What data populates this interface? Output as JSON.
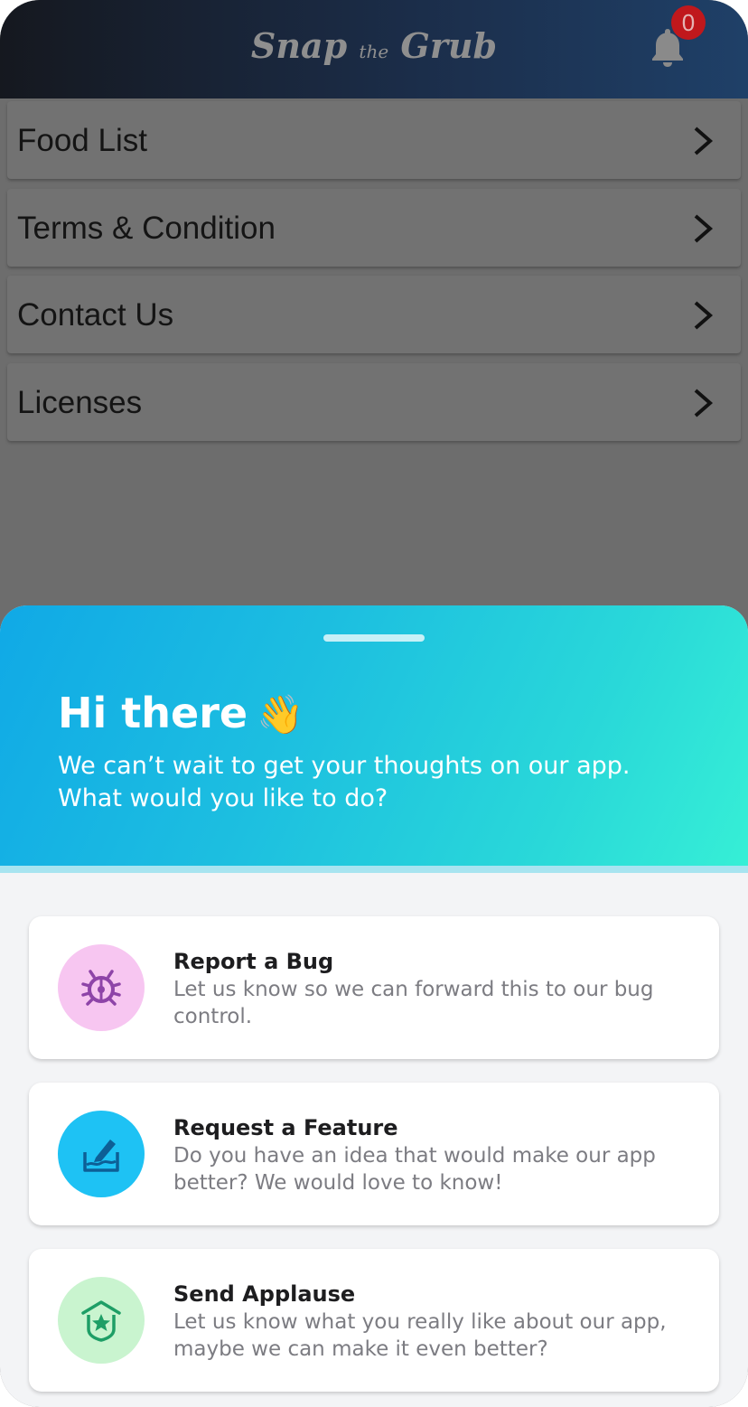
{
  "header": {
    "logo_main1": "Snap",
    "logo_small": "the",
    "logo_main2": "Grub",
    "notification_count": "0",
    "bell_icon": "bell-icon"
  },
  "menu": {
    "items": [
      {
        "label": "Food List",
        "icon": "chevron-right-icon"
      },
      {
        "label": "Terms & Condition",
        "icon": "chevron-right-icon"
      },
      {
        "label": "Contact Us",
        "icon": "chevron-right-icon"
      },
      {
        "label": "Licenses",
        "icon": "chevron-right-icon"
      }
    ]
  },
  "sheet": {
    "title": "Hi there",
    "title_emoji": "👋",
    "subtitle_line1": "We can’t wait to get your thoughts on our app.",
    "subtitle_line2": "What would you like to do?",
    "options": [
      {
        "title": "Report a Bug",
        "description": "Let us know so we can forward this to our bug control.",
        "icon": "bug-icon",
        "icon_bg": "#f7c6f1",
        "icon_color": "#8e44a8"
      },
      {
        "title": "Request a Feature",
        "description": "Do you have an idea that would make our app better? We would love to know!",
        "icon": "edit-feature-icon",
        "icon_bg": "#1ec2f4",
        "icon_color": "#0d5f96"
      },
      {
        "title": "Send Applause",
        "description": "Let us know what you really like about our app, maybe we can make it even better?",
        "icon": "applause-star-icon",
        "icon_bg": "#c9f4cf",
        "icon_color": "#1e9e66"
      }
    ]
  },
  "colors": {
    "header_gradient_start": "#15181f",
    "header_gradient_end": "#1f4068",
    "badge": "#c0181c",
    "overlay_gray": "#6d6d6d",
    "hero_gradient_start": "#10a9e6",
    "hero_gradient_end": "#36efd6"
  }
}
